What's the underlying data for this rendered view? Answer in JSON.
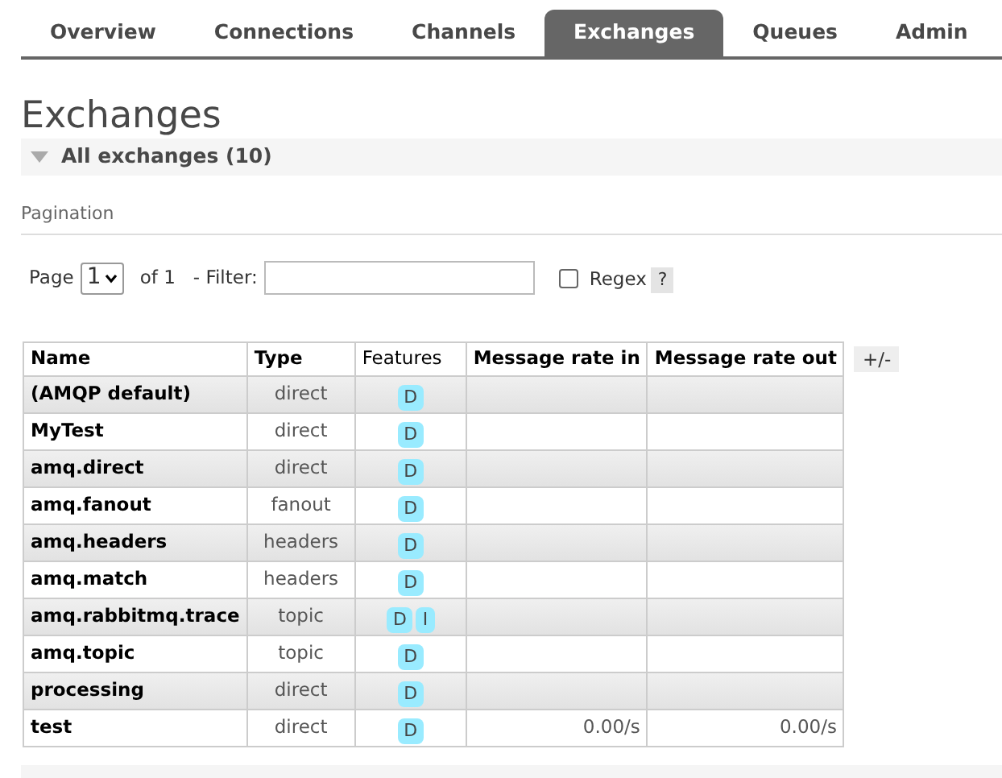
{
  "tabs": [
    {
      "label": "Overview",
      "selected": false
    },
    {
      "label": "Connections",
      "selected": false
    },
    {
      "label": "Channels",
      "selected": false
    },
    {
      "label": "Exchanges",
      "selected": true
    },
    {
      "label": "Queues",
      "selected": false
    },
    {
      "label": "Admin",
      "selected": false
    }
  ],
  "title": "Exchanges",
  "section": {
    "label": "All exchanges (10)",
    "expanded": true
  },
  "pagination": {
    "heading": "Pagination",
    "page_label": "Page",
    "page_value": "1",
    "of_label": "of 1",
    "filter_label": "- Filter:",
    "regex_label": "Regex",
    "regex_checked": false,
    "help": "?"
  },
  "table": {
    "columns": [
      "Name",
      "Type",
      "Features",
      "Message rate in",
      "Message rate out"
    ],
    "toggle": "+/-",
    "rows": [
      {
        "name": "(AMQP default)",
        "type": "direct",
        "features": [
          "D"
        ]
      },
      {
        "name": "MyTest",
        "type": "direct",
        "features": [
          "D"
        ]
      },
      {
        "name": "amq.direct",
        "type": "direct",
        "features": [
          "D"
        ]
      },
      {
        "name": "amq.fanout",
        "type": "fanout",
        "features": [
          "D"
        ]
      },
      {
        "name": "amq.headers",
        "type": "headers",
        "features": [
          "D"
        ]
      },
      {
        "name": "amq.match",
        "type": "headers",
        "features": [
          "D"
        ]
      },
      {
        "name": "amq.rabbitmq.trace",
        "type": "topic",
        "features": [
          "D",
          "I"
        ]
      },
      {
        "name": "amq.topic",
        "type": "topic",
        "features": [
          "D"
        ]
      },
      {
        "name": "processing",
        "type": "direct",
        "features": [
          "D"
        ]
      },
      {
        "name": "test",
        "type": "direct",
        "features": [
          "D"
        ],
        "rate_in": "0.00/s",
        "rate_out": "0.00/s"
      }
    ]
  }
}
